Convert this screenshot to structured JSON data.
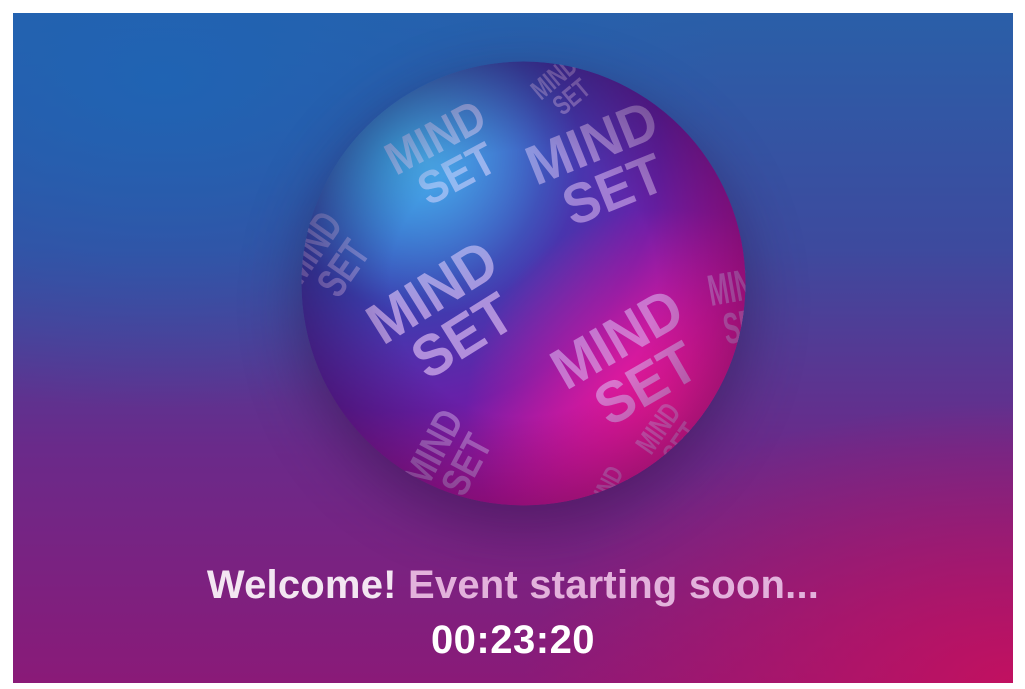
{
  "logo": {
    "word_top": "MIND",
    "word_bottom": "SET",
    "icon": "mindset-globe-icon"
  },
  "welcome": {
    "greeting": "Welcome!",
    "message": "Event starting soon..."
  },
  "countdown": {
    "value": "00:23:20"
  },
  "colors": {
    "background_top": "#2a5fa8",
    "background_bottom": "#8a1a78",
    "accent_magenta": "#e0119c",
    "accent_blue": "#1e8fdf",
    "text_light": "#f3e6f2",
    "text_soft": "#e3b2dc"
  }
}
